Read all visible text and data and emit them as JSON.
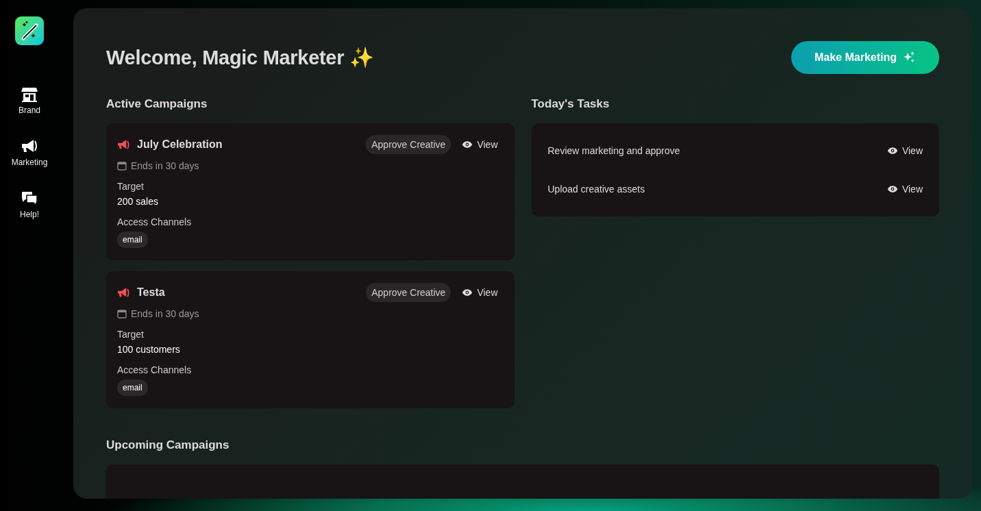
{
  "sidebar": {
    "items": [
      {
        "label": "Brand",
        "kind": "store"
      },
      {
        "label": "Marketing",
        "kind": "megaphone"
      },
      {
        "label": "Help!",
        "kind": "chat"
      }
    ]
  },
  "header": {
    "title": "Welcome, Magic Marketer ✨",
    "action": "Make Marketing"
  },
  "active_campaigns": {
    "heading": "Active Campaigns",
    "items": [
      {
        "name": "July Celebration",
        "badge": "Approve Creative",
        "view": "View",
        "ends": "Ends in 30 days",
        "target_label": "Target",
        "target": "200 sales",
        "channels_label": "Access Channels",
        "channels": [
          "email"
        ]
      },
      {
        "name": "Testa",
        "badge": "Approve Creative",
        "view": "View",
        "ends": "Ends in 30 days",
        "target_label": "Target",
        "target": "100 customers",
        "channels_label": "Access Channels",
        "channels": [
          "email"
        ]
      }
    ]
  },
  "tasks": {
    "heading": "Today's Tasks",
    "items": [
      {
        "label": "Review marketing and approve",
        "view": "View"
      },
      {
        "label": "Upload creative assets",
        "view": "View"
      }
    ]
  },
  "upcoming_campaigns": {
    "heading": "Upcoming Campaigns"
  }
}
